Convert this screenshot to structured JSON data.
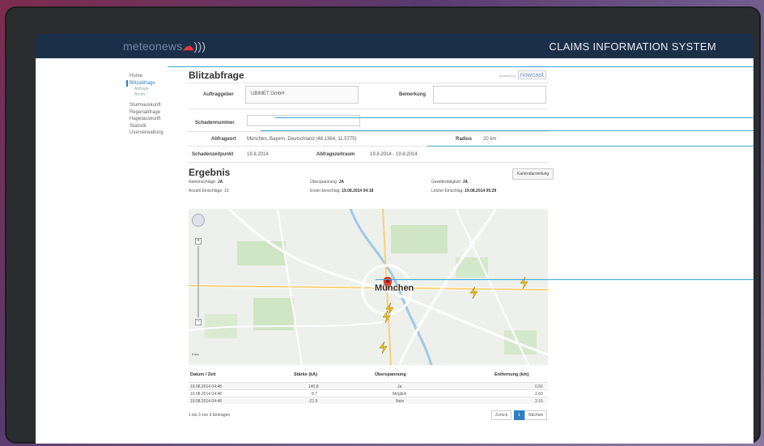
{
  "brand": {
    "name": "meteonews",
    "system": "CLAIMS INFORMATION SYSTEM"
  },
  "sidebar": {
    "items": [
      {
        "label": "Home"
      },
      {
        "label": "Blitzabfrage",
        "active": true
      },
      {
        "label": "Anfrage",
        "sub": true
      },
      {
        "label": "Archiv",
        "sub": true
      },
      {
        "label": "Sturmauskunft"
      },
      {
        "label": "Regenabfrage"
      },
      {
        "label": "Hagelauskunft"
      },
      {
        "label": "Statistik"
      },
      {
        "label": "Userverwaltung"
      }
    ]
  },
  "page": {
    "title": "Blitzabfrage",
    "powered_by": "powered by",
    "nowcast": "nowcast"
  },
  "form": {
    "auftraggeber_label": "Auftraggeber",
    "auftraggeber_value": "UBIMET GmbH",
    "bemerkung_label": "Bemerkung",
    "schadennummer_label": "Schadennummer",
    "abfrageort_label": "Abfrageort",
    "abfrageort_value": "München, Bayern, Deutschland (48.1364, 11.5775)",
    "radius_label": "Radius",
    "radius_value": "20 km",
    "schadenzeitpunkt_label": "Schadenzeitpunkt",
    "schadenzeitpunkt_value": "19.8.2014",
    "abfragezeitraum_label": "Abfragezeitraum",
    "abfragezeitraum_value": "19.8.2014 - 19.8.2014"
  },
  "result": {
    "title": "Ergebnis",
    "map_button": "Kartendarstellung",
    "naheinschlaege": "Naheinschläge:",
    "naheinschlaege_val": "JA",
    "ueberspannung": "Überspannung:",
    "ueberspannung_val": "JA",
    "gewitter": "Gewittertätigkeit:",
    "gewitter_val": "JA",
    "anzahl": "Anzahl Einschläge: 10",
    "erster": "Erster Einschlag:",
    "erster_val": "19.08.2014 04:18",
    "letzter": "Letzter Einschlag:",
    "letzter_val": "19.08.2014 05:29"
  },
  "map": {
    "city": "München",
    "scale": "2 km"
  },
  "table": {
    "headers": [
      "Datum / Zeit",
      "Stärke (kA)",
      "Überspannung",
      "Entfernung (km)"
    ],
    "rows": [
      [
        "19.08.2014 04:48",
        "140.8",
        "Ja",
        "0.56"
      ],
      [
        "19.08.2014 04:48",
        "8.7",
        "Möglich",
        "2.60"
      ],
      [
        "19.08.2014 04:48",
        "-21.5",
        "Nein",
        "3.16"
      ]
    ],
    "info": "1 bis 3 von 3 Einträgen",
    "prev": "Zurück",
    "page": "1",
    "next": "Nächste"
  }
}
